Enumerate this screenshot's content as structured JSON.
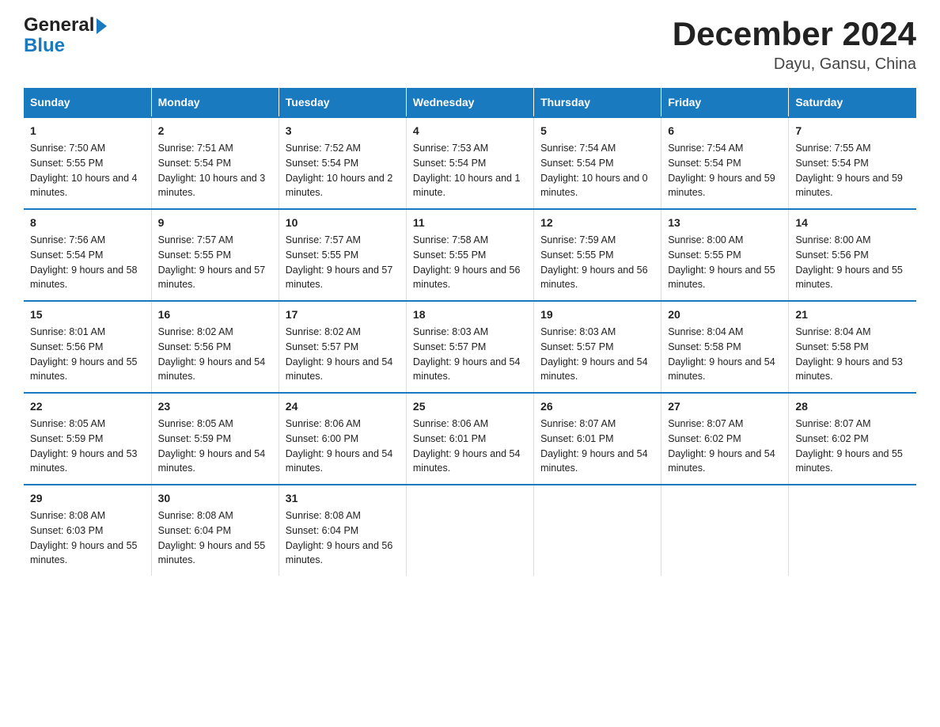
{
  "header": {
    "logo_general": "General",
    "logo_blue": "Blue",
    "title": "December 2024",
    "subtitle": "Dayu, Gansu, China"
  },
  "days_of_week": [
    "Sunday",
    "Monday",
    "Tuesday",
    "Wednesday",
    "Thursday",
    "Friday",
    "Saturday"
  ],
  "weeks": [
    [
      {
        "day": "1",
        "sunrise": "7:50 AM",
        "sunset": "5:55 PM",
        "daylight": "10 hours and 4 minutes."
      },
      {
        "day": "2",
        "sunrise": "7:51 AM",
        "sunset": "5:54 PM",
        "daylight": "10 hours and 3 minutes."
      },
      {
        "day": "3",
        "sunrise": "7:52 AM",
        "sunset": "5:54 PM",
        "daylight": "10 hours and 2 minutes."
      },
      {
        "day": "4",
        "sunrise": "7:53 AM",
        "sunset": "5:54 PM",
        "daylight": "10 hours and 1 minute."
      },
      {
        "day": "5",
        "sunrise": "7:54 AM",
        "sunset": "5:54 PM",
        "daylight": "10 hours and 0 minutes."
      },
      {
        "day": "6",
        "sunrise": "7:54 AM",
        "sunset": "5:54 PM",
        "daylight": "9 hours and 59 minutes."
      },
      {
        "day": "7",
        "sunrise": "7:55 AM",
        "sunset": "5:54 PM",
        "daylight": "9 hours and 59 minutes."
      }
    ],
    [
      {
        "day": "8",
        "sunrise": "7:56 AM",
        "sunset": "5:54 PM",
        "daylight": "9 hours and 58 minutes."
      },
      {
        "day": "9",
        "sunrise": "7:57 AM",
        "sunset": "5:55 PM",
        "daylight": "9 hours and 57 minutes."
      },
      {
        "day": "10",
        "sunrise": "7:57 AM",
        "sunset": "5:55 PM",
        "daylight": "9 hours and 57 minutes."
      },
      {
        "day": "11",
        "sunrise": "7:58 AM",
        "sunset": "5:55 PM",
        "daylight": "9 hours and 56 minutes."
      },
      {
        "day": "12",
        "sunrise": "7:59 AM",
        "sunset": "5:55 PM",
        "daylight": "9 hours and 56 minutes."
      },
      {
        "day": "13",
        "sunrise": "8:00 AM",
        "sunset": "5:55 PM",
        "daylight": "9 hours and 55 minutes."
      },
      {
        "day": "14",
        "sunrise": "8:00 AM",
        "sunset": "5:56 PM",
        "daylight": "9 hours and 55 minutes."
      }
    ],
    [
      {
        "day": "15",
        "sunrise": "8:01 AM",
        "sunset": "5:56 PM",
        "daylight": "9 hours and 55 minutes."
      },
      {
        "day": "16",
        "sunrise": "8:02 AM",
        "sunset": "5:56 PM",
        "daylight": "9 hours and 54 minutes."
      },
      {
        "day": "17",
        "sunrise": "8:02 AM",
        "sunset": "5:57 PM",
        "daylight": "9 hours and 54 minutes."
      },
      {
        "day": "18",
        "sunrise": "8:03 AM",
        "sunset": "5:57 PM",
        "daylight": "9 hours and 54 minutes."
      },
      {
        "day": "19",
        "sunrise": "8:03 AM",
        "sunset": "5:57 PM",
        "daylight": "9 hours and 54 minutes."
      },
      {
        "day": "20",
        "sunrise": "8:04 AM",
        "sunset": "5:58 PM",
        "daylight": "9 hours and 54 minutes."
      },
      {
        "day": "21",
        "sunrise": "8:04 AM",
        "sunset": "5:58 PM",
        "daylight": "9 hours and 53 minutes."
      }
    ],
    [
      {
        "day": "22",
        "sunrise": "8:05 AM",
        "sunset": "5:59 PM",
        "daylight": "9 hours and 53 minutes."
      },
      {
        "day": "23",
        "sunrise": "8:05 AM",
        "sunset": "5:59 PM",
        "daylight": "9 hours and 54 minutes."
      },
      {
        "day": "24",
        "sunrise": "8:06 AM",
        "sunset": "6:00 PM",
        "daylight": "9 hours and 54 minutes."
      },
      {
        "day": "25",
        "sunrise": "8:06 AM",
        "sunset": "6:01 PM",
        "daylight": "9 hours and 54 minutes."
      },
      {
        "day": "26",
        "sunrise": "8:07 AM",
        "sunset": "6:01 PM",
        "daylight": "9 hours and 54 minutes."
      },
      {
        "day": "27",
        "sunrise": "8:07 AM",
        "sunset": "6:02 PM",
        "daylight": "9 hours and 54 minutes."
      },
      {
        "day": "28",
        "sunrise": "8:07 AM",
        "sunset": "6:02 PM",
        "daylight": "9 hours and 55 minutes."
      }
    ],
    [
      {
        "day": "29",
        "sunrise": "8:08 AM",
        "sunset": "6:03 PM",
        "daylight": "9 hours and 55 minutes."
      },
      {
        "day": "30",
        "sunrise": "8:08 AM",
        "sunset": "6:04 PM",
        "daylight": "9 hours and 55 minutes."
      },
      {
        "day": "31",
        "sunrise": "8:08 AM",
        "sunset": "6:04 PM",
        "daylight": "9 hours and 56 minutes."
      },
      null,
      null,
      null,
      null
    ]
  ],
  "labels": {
    "sunrise": "Sunrise:",
    "sunset": "Sunset:",
    "daylight": "Daylight:"
  }
}
